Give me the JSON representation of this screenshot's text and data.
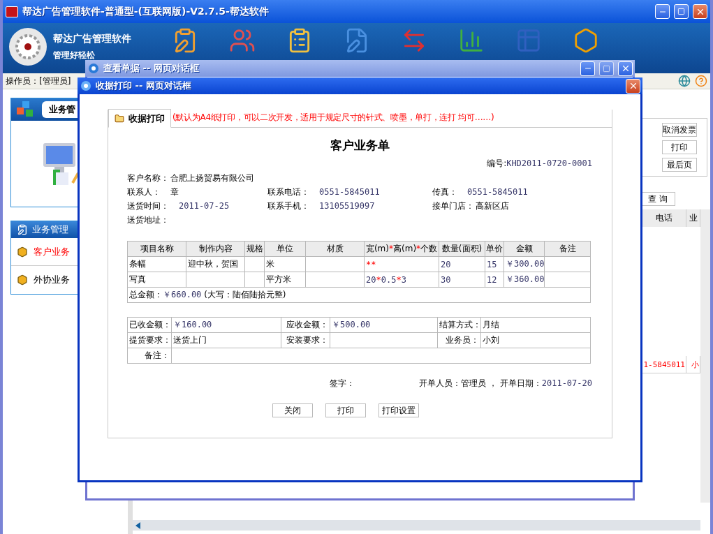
{
  "main_window": {
    "title": "帮达广告管理软件-普通型-(互联网版)-V2.7.5-帮达软件"
  },
  "banner": {
    "brand": "帮达广告管理软件",
    "slogan": "管理好轻松"
  },
  "status_bar": {
    "operator": "操作员：[管理员]"
  },
  "sidebar": {
    "panel_title": "业务管",
    "section_title": "业务管理",
    "items": [
      {
        "label": "客户业务",
        "selected": true
      },
      {
        "label": "外协业务",
        "selected": false
      }
    ]
  },
  "background_content": {
    "buttons": [
      {
        "label": "取消发票",
        "disabled": false
      },
      {
        "label": "打印",
        "disabled": false
      },
      {
        "label": "最后页",
        "disabled": false
      }
    ],
    "query_button": "查 询",
    "table": {
      "columns": [
        "电话",
        "业"
      ],
      "rows": [
        [
          "1-5845011",
          "小"
        ]
      ]
    }
  },
  "back_dialog": {
    "title": "查看单据 -- 网页对话框"
  },
  "dialog": {
    "title": "收据打印 -- 网页对话框",
    "tab": "收据打印",
    "note": "(默认为A4纸打印，可以二次开发，适用于规定尺寸的针式、喷墨，单打，连打 均可……)",
    "form_title": "客户业务单",
    "number": {
      "label": "编号:",
      "value": "KHD2011-0720-0001"
    },
    "fields": [
      {
        "label": "客户名称：",
        "value": "合肥上扬贸易有限公司",
        "kind": "text"
      },
      {
        "label": "联系人：",
        "value": "章",
        "kind": "text"
      },
      {
        "label": "联系电话：",
        "value": "0551-5845011",
        "kind": "number"
      },
      {
        "label": "传真：",
        "value": "0551-5845011",
        "kind": "number"
      },
      {
        "label": "送货时间：",
        "value": "2011-07-25",
        "kind": "number"
      },
      {
        "label": "联系手机：",
        "value": "13105519097",
        "kind": "number"
      },
      {
        "label": "接单门店：",
        "value": "高新区店",
        "kind": "text"
      },
      {
        "label": "送货地址："
      }
    ],
    "items_table": {
      "columns": [
        "项目名称",
        "制作内容",
        "规格",
        "单位",
        "材质",
        "宽(m)*高(m)*个数",
        "数量(面积)",
        "单价",
        "金额",
        "备注"
      ],
      "rows": [
        [
          "条幅",
          "迎中秋，贺国",
          "",
          "米",
          "",
          "**",
          "20",
          "15",
          "￥300.00",
          ""
        ],
        [
          "写真",
          "",
          "",
          "平方米",
          "",
          "20*0.5*3",
          "30",
          "12",
          "￥360.00",
          ""
        ]
      ],
      "total": {
        "label": "总金额：",
        "value": "￥660.00",
        "words": "(大写：陆佰陆拾元整)"
      }
    },
    "payment_table": [
      [
        {
          "text": "已收金额：",
          "kind": "label"
        },
        {
          "text": "￥160.00",
          "kind": "number"
        },
        {
          "text": "应收金额：",
          "kind": "label"
        },
        {
          "text": "￥500.00",
          "kind": "number"
        },
        {
          "text": "结算方式：",
          "kind": "label"
        },
        {
          "text": "月结",
          "kind": "text"
        }
      ],
      [
        {
          "text": "提货要求：",
          "kind": "label"
        },
        {
          "text": "送货上门",
          "kind": "text"
        },
        {
          "text": "安装要求：",
          "kind": "label"
        },
        {
          "kind": "text"
        },
        {
          "text": "业务员：",
          "kind": "label"
        },
        {
          "text": "小刘",
          "kind": "text"
        }
      ],
      [
        {
          "text": "备注：",
          "kind": "label"
        },
        {
          "kind": "wide"
        }
      ]
    ],
    "signature": {
      "label": "签字：",
      "issuer": "开单人员：管理员 ， 开单日期：",
      "date": "2011-07-20"
    },
    "buttons": [
      "关闭",
      "打印",
      "打印设置"
    ]
  }
}
